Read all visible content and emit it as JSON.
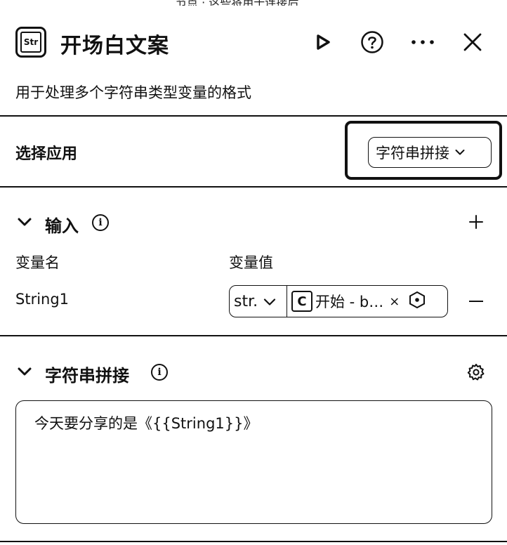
{
  "top_partial_text": "节点 · 这些将用于连接后",
  "node": {
    "icon_label": "Str",
    "title": "开场白文案",
    "description": "用于处理多个字符串类型变量的格式"
  },
  "header_icons": [
    "play-icon",
    "help-icon",
    "more-icon",
    "close-icon"
  ],
  "select_app": {
    "label": "选择应用",
    "value": "字符串拼接"
  },
  "input_section": {
    "title": "输入",
    "col_name": "变量名",
    "col_value": "变量值",
    "rows": [
      {
        "name": "String1",
        "type": "str.",
        "ref_icon": "C",
        "ref_text": "开始 - b…",
        "ref_clear": "×"
      }
    ]
  },
  "concat_section": {
    "title": "字符串拼接",
    "template": "今天要分享的是《{{String1}}》"
  }
}
